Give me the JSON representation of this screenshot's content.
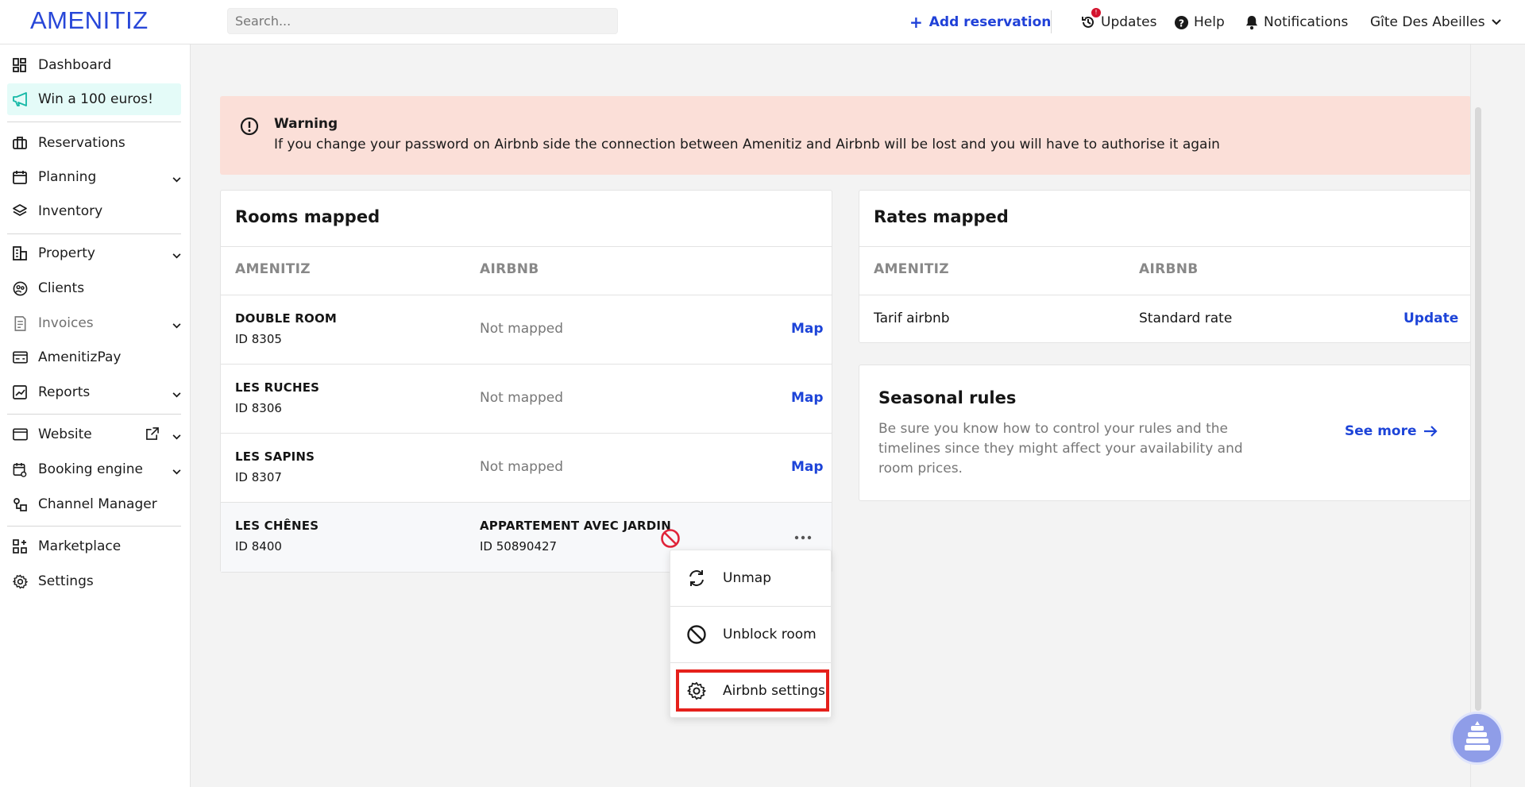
{
  "header": {
    "logo": "AMENITIZ",
    "search_placeholder": "Search...",
    "add_reservation": "Add reservation",
    "updates": "Updates",
    "updates_badge": "!",
    "help": "Help",
    "notifications": "Notifications",
    "hotel_name": "Gîte Des Abeilles"
  },
  "sidebar": {
    "items": [
      {
        "label": "Dashboard",
        "icon": "dashboard-icon"
      },
      {
        "label": "Win a 100 euros!",
        "icon": "megaphone-icon"
      },
      {
        "label": "Reservations",
        "icon": "suitcase-icon"
      },
      {
        "label": "Planning",
        "icon": "calendar-icon"
      },
      {
        "label": "Inventory",
        "icon": "layers-icon"
      },
      {
        "label": "Property",
        "icon": "building-icon"
      },
      {
        "label": "Clients",
        "icon": "clients-icon"
      },
      {
        "label": "Invoices",
        "icon": "invoice-icon"
      },
      {
        "label": "AmenitizPay",
        "icon": "card-reader-icon"
      },
      {
        "label": "Reports",
        "icon": "chart-icon"
      },
      {
        "label": "Website",
        "icon": "browser-icon"
      },
      {
        "label": "Booking engine",
        "icon": "booking-icon"
      },
      {
        "label": "Channel Manager",
        "icon": "channel-icon"
      },
      {
        "label": "Marketplace",
        "icon": "marketplace-icon"
      },
      {
        "label": "Settings",
        "icon": "gear-icon"
      }
    ]
  },
  "warning": {
    "title": "Warning",
    "text": "If you change your password on Airbnb side the connection between Amenitiz and Airbnb will be lost and you will have to authorise it again"
  },
  "rooms": {
    "title": "Rooms mapped",
    "col_amenitiz": "AMENITIZ",
    "col_airbnb": "AIRBNB",
    "rows": [
      {
        "name": "DOUBLE ROOM",
        "id": "ID 8305",
        "airbnb": "Not mapped",
        "action": "Map"
      },
      {
        "name": "LES RUCHES",
        "id": "ID 8306",
        "airbnb": "Not mapped",
        "action": "Map"
      },
      {
        "name": "LES SAPINS",
        "id": "ID 8307",
        "airbnb": "Not mapped",
        "action": "Map"
      },
      {
        "name": "LES CHÊNES",
        "id": "ID 8400",
        "airbnb_name": "APPARTEMENT AVEC JARDIN",
        "airbnb_id": "ID 50890427"
      }
    ]
  },
  "rates": {
    "title": "Rates mapped",
    "col_amenitiz": "AMENITIZ",
    "col_airbnb": "AIRBNB",
    "row": {
      "amenitiz": "Tarif airbnb",
      "airbnb": "Standard rate",
      "action": "Update"
    }
  },
  "seasonal": {
    "title": "Seasonal rules",
    "text": "Be sure you know how to control your rules and the timelines since they might affect your availability and room prices.",
    "link": "See more"
  },
  "menu": {
    "unmap": "Unmap",
    "unblock": "Unblock room",
    "airbnb_settings": "Airbnb settings"
  },
  "colors": {
    "brand": "#2847d8",
    "warning_bg": "#fbdfd8",
    "highlight": "#e5201b"
  }
}
